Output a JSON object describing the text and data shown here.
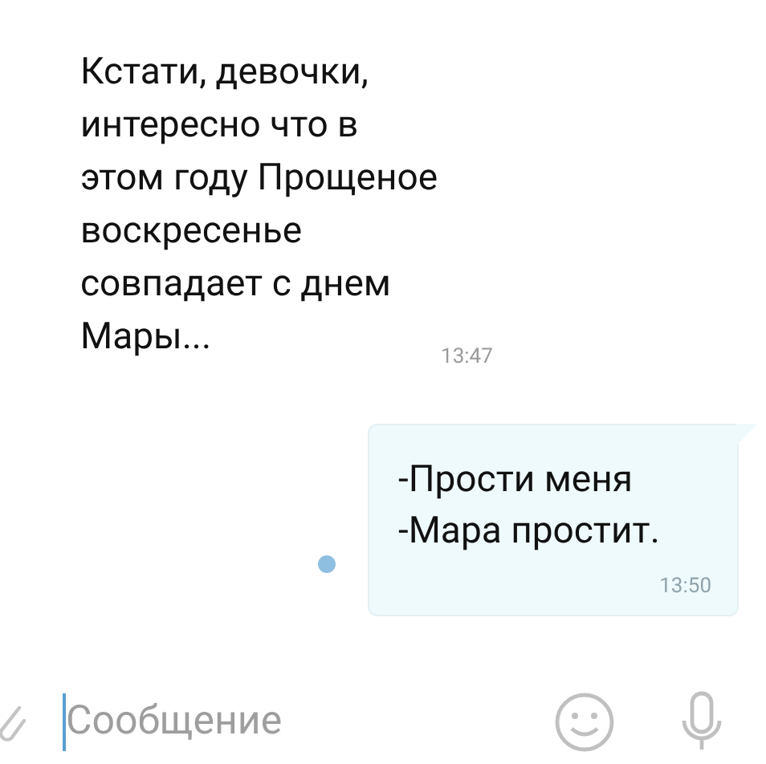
{
  "messages": [
    {
      "kind": "incoming",
      "lines": [
        "Кстати, девочки,",
        "интересно что в",
        "этом году Прощеное",
        "воскресенье",
        "совпадает с днем",
        "Мары..."
      ],
      "time": "13:47"
    },
    {
      "kind": "outgoing",
      "lines": [
        "-Прости меня",
        "-Мара простит."
      ],
      "time": "13:50",
      "unread": true
    }
  ],
  "composer": {
    "placeholder": "Сообщение"
  }
}
